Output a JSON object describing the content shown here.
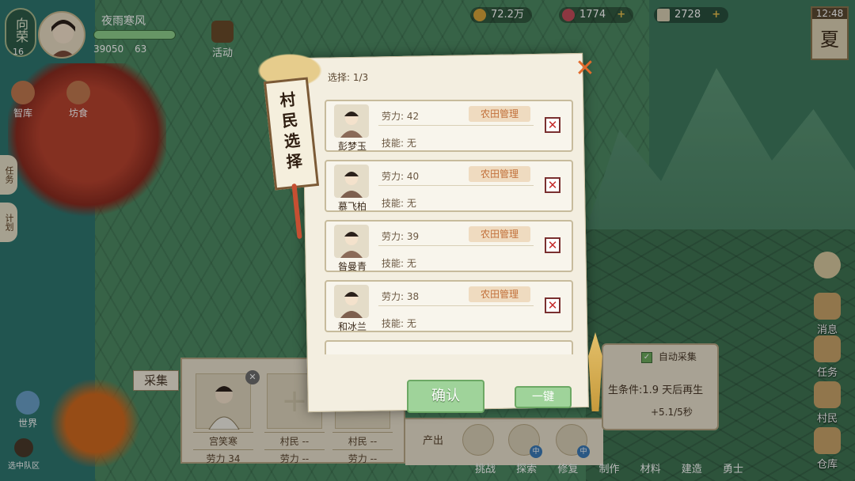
{
  "header": {
    "player_name": "夜雨寒风",
    "level_label": "向荣",
    "level": "16",
    "stat_a": "39050",
    "stat_b": "63",
    "event_label": "活动",
    "coins": "72.2万",
    "gems": "1774",
    "tickets": "2728",
    "time": "12:48",
    "season": "夏"
  },
  "left_menu": [
    "智库",
    "坊食",
    "任务",
    "计划",
    "世界",
    "选中队区"
  ],
  "right_menu": [
    "消息",
    "任务",
    "村民",
    "仓库"
  ],
  "dialog": {
    "title": "村民选择",
    "select_count": "选择: 1/3",
    "villagers": [
      {
        "name": "彭梦玉",
        "labor": "劳力: 42",
        "tag": "农田管理",
        "skill": "技能: 无",
        "selected": false
      },
      {
        "name": "慕飞柏",
        "labor": "劳力: 40",
        "tag": "农田管理",
        "skill": "技能: 无",
        "selected": false
      },
      {
        "name": "昝曼青",
        "labor": "劳力: 39",
        "tag": "农田管理",
        "skill": "技能: 无",
        "selected": false
      },
      {
        "name": "和冰兰",
        "labor": "劳力: 38",
        "tag": "农田管理",
        "skill": "技能: 无",
        "selected": false
      }
    ],
    "confirm_label": "确认",
    "one_key_label": "一键"
  },
  "collect_panel": {
    "tag": "采集",
    "slots": [
      {
        "name": "宫笑寒",
        "labor": "劳力 34"
      },
      {
        "name": "村民 --",
        "labor": "劳力 --"
      },
      {
        "name": "村民 --",
        "labor": "劳力 --"
      }
    ],
    "output_label": "产出",
    "output_badge": "中",
    "auto_collect": "自动采集",
    "condition": "生条件:1.9 天后再生",
    "rate": "+5.1/5秒"
  },
  "bottom_nav": [
    "挑战",
    "探索",
    "修复",
    "制作",
    "材料",
    "建造",
    "勇士"
  ],
  "colors": {
    "accent_close": "#e26b2c",
    "tag_text": "#c2703a",
    "confirm_green": "#9fd39a",
    "checkbox_red": "#c52a2a"
  }
}
